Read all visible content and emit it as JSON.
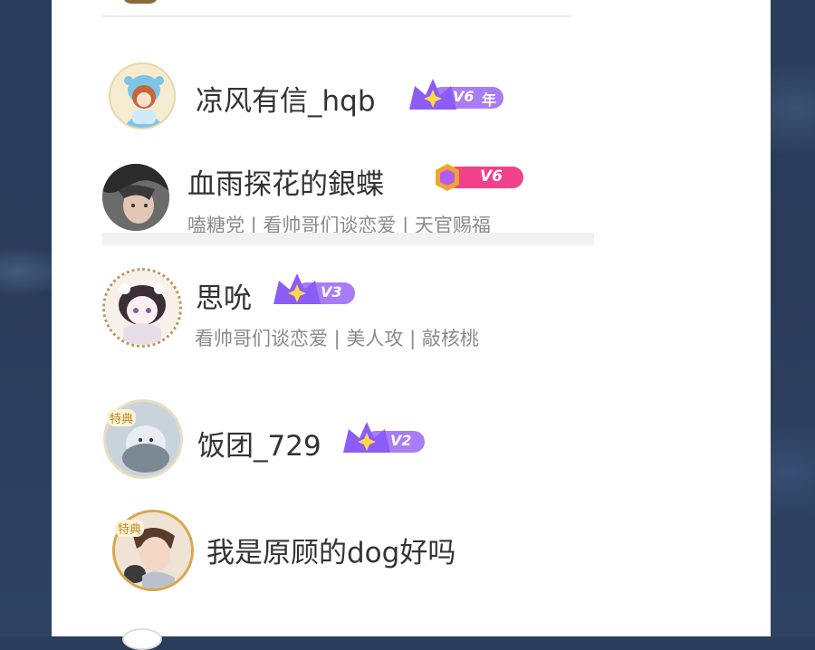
{
  "users": [
    {
      "name": "凉风有信_hqb",
      "level": "V6",
      "suffix": "年",
      "tags": ""
    },
    {
      "name": "血雨探花的銀蝶",
      "level": "V6",
      "suffix": "",
      "tags": "嗑糖党 | 看帅哥们谈恋爱 | 天官赐福"
    },
    {
      "name": "思吮",
      "level": "V3",
      "suffix": "",
      "tags": "看帅哥们谈恋爱 | 美人攻 | 敲核桃"
    },
    {
      "name": "饭团_729",
      "level": "V2",
      "suffix": "",
      "tags": ""
    },
    {
      "name": "我是原顾的dog好吗",
      "level": "",
      "suffix": "",
      "tags": ""
    }
  ],
  "frames": {
    "f1": "特典",
    "f2": "特典"
  },
  "colors": {
    "crown_purple": "#8b5cf6",
    "pill_pink": "#f0418a",
    "text_main": "#333333",
    "text_tag": "#8a8a8a"
  },
  "icons": [
    "crown-badge-icon",
    "hexagon-badge-icon",
    "sparkle-star-icon"
  ]
}
